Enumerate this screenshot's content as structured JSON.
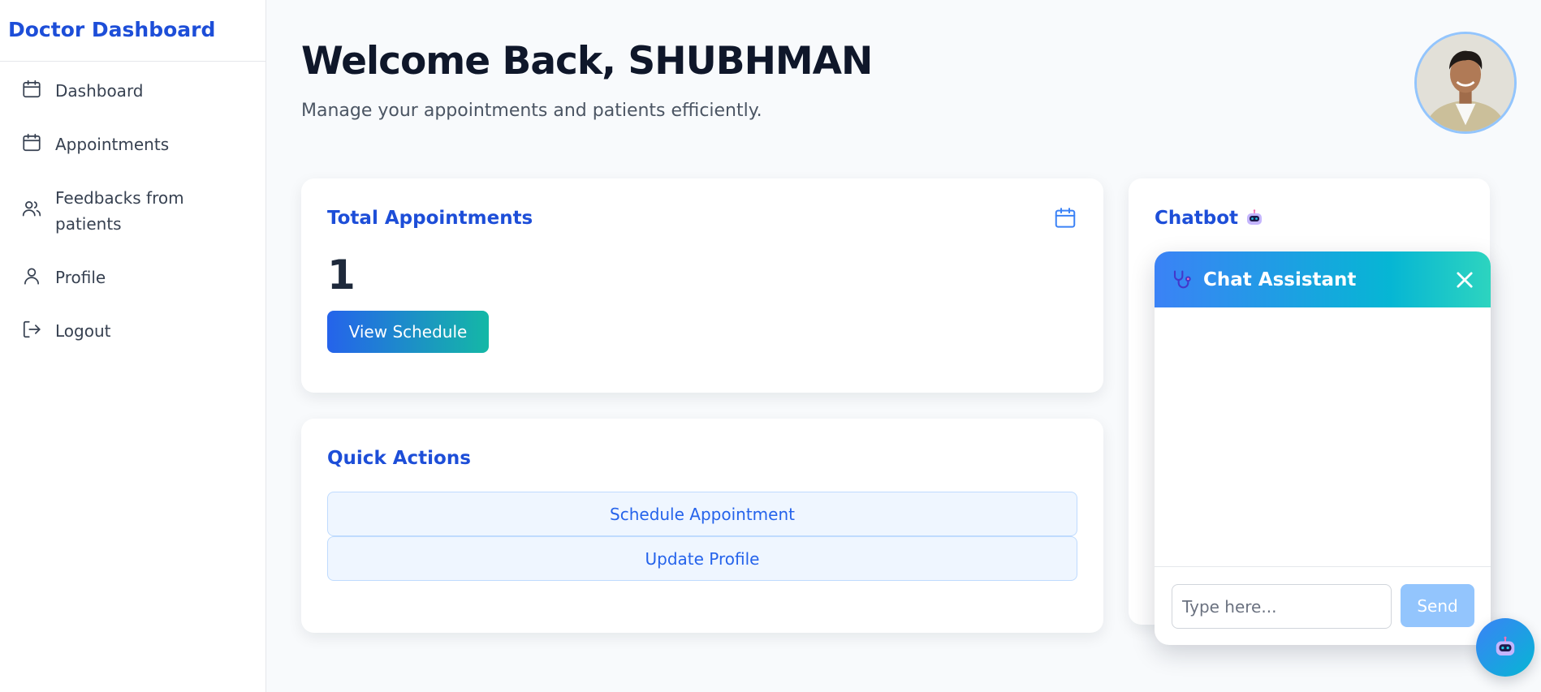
{
  "sidebar": {
    "brand": "Doctor Dashboard",
    "items": [
      {
        "label": "Dashboard",
        "icon": "calendar-icon"
      },
      {
        "label": "Appointments",
        "icon": "calendar-icon"
      },
      {
        "label": "Feedbacks from patients",
        "icon": "users-icon"
      },
      {
        "label": "Profile",
        "icon": "user-icon"
      },
      {
        "label": "Logout",
        "icon": "logout-icon"
      }
    ]
  },
  "header": {
    "title": "Welcome Back, SHUBHMAN",
    "subtitle": "Manage your appointments and patients efficiently."
  },
  "total_appointments": {
    "title": "Total Appointments",
    "count": "1",
    "button_label": "View Schedule"
  },
  "quick_actions": {
    "title": "Quick Actions",
    "buttons": [
      "Schedule Appointment",
      "Update Profile"
    ]
  },
  "chatbot": {
    "title": "Chatbot"
  },
  "chat_widget": {
    "title": "Chat Assistant",
    "input_placeholder": "Type here...",
    "send_label": "Send"
  },
  "colors": {
    "brand": "#1d4ed8",
    "gradient_start": "#2563eb",
    "gradient_end": "#14b8a6",
    "send_button": "#93c5fd"
  }
}
